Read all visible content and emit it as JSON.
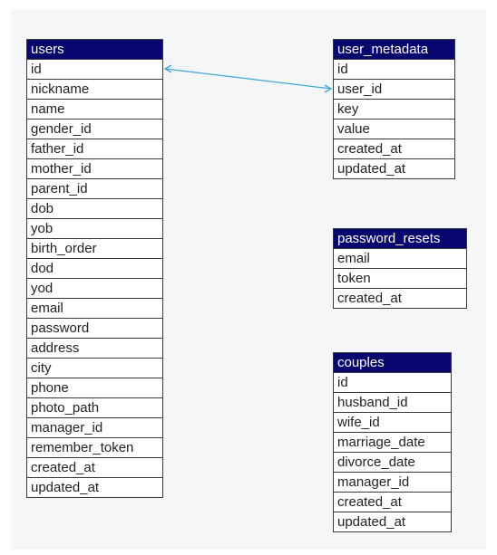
{
  "tables": [
    {
      "key": "users",
      "name": "users",
      "columns": [
        "id",
        "nickname",
        "name",
        "gender_id",
        "father_id",
        "mother_id",
        "parent_id",
        "dob",
        "yob",
        "birth_order",
        "dod",
        "yod",
        "email",
        "password",
        "address",
        "city",
        "phone",
        "photo_path",
        "manager_id",
        "remember_token",
        "created_at",
        "updated_at"
      ]
    },
    {
      "key": "user_metadata",
      "name": "user_metadata",
      "columns": [
        "id",
        "user_id",
        "key",
        "value",
        "created_at",
        "updated_at"
      ]
    },
    {
      "key": "password_resets",
      "name": "password_resets",
      "columns": [
        "email",
        "token",
        "created_at"
      ]
    },
    {
      "key": "couples",
      "name": "couples",
      "columns": [
        "id",
        "husband_id",
        "wife_id",
        "marriage_date",
        "divorce_date",
        "manager_id",
        "created_at",
        "updated_at"
      ]
    }
  ],
  "relations": [
    {
      "from_table": "user_metadata",
      "from_column": "user_id",
      "to_table": "users",
      "to_column": "id"
    }
  ],
  "colors": {
    "header_bg": "#06066e",
    "header_text": "#ffffff",
    "relation_line": "#3fa7d6",
    "border": "#3a3a3a"
  }
}
